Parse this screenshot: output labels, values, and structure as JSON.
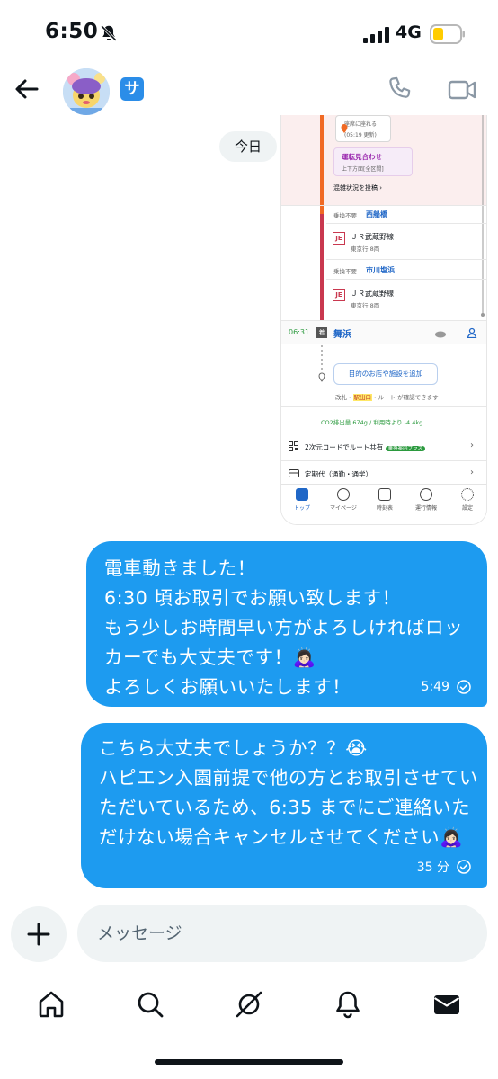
{
  "status_bar": {
    "time": "6:50",
    "network": "4G"
  },
  "header": {
    "badge": "サ"
  },
  "date_chip": "今日",
  "shared_image": {
    "location_card": {
      "line1": "座席に座れる",
      "line2": "(05:19 更新)"
    },
    "alert_card": {
      "title": "運転見合わせ",
      "sub": "上下方面[全区間]"
    },
    "congestion": "混雑状況を投稿",
    "stops": [
      {
        "transfer": "乗換不要",
        "station": "西船橋",
        "line": "ＪＲ武蔵野線",
        "dest": "東京行 8両"
      },
      {
        "transfer": "乗換不要",
        "station": "市川塩浜",
        "line": "ＪＲ武蔵野線",
        "dest": "東京行 8両"
      }
    ],
    "jr_mark": "JE",
    "arrival": {
      "time": "06:31",
      "marker": "着",
      "station": "舞浜"
    },
    "add_button": "目的のお店や施設を追加",
    "route_note_pre": "改札・",
    "route_note_exit": "駅出口",
    "route_note_post": "・ルート が確認できます",
    "co2": "CO2排出量 674g / 利用時より -4.4kg",
    "qr_share": "2次元コードでルート共有",
    "qr_badge": "乗換案内プラス",
    "commuter": "定期代（通勤・通学）",
    "tabs": [
      "トップ",
      "マイページ",
      "時刻表",
      "運行情報",
      "設定"
    ]
  },
  "messages": [
    {
      "text": "電車動きました！\n6:30 頃お取引でお願い致します！\nもう少しお時間早い方がよろしければロッカーでも大丈夫です！🙇🏻‍♀️\nよろしくお願いいたします！",
      "time": "5:49"
    },
    {
      "text": "こちら大丈夫でしょうか？？😭\nハピエン入園前提で他の方とお取引させていただいているため、6:35 までにご連絡いただけない場合キャンセルさせてください🙇🏻‍♀️",
      "time": "35 分"
    }
  ],
  "composer": {
    "placeholder": "メッセージ"
  },
  "colors": {
    "bubble": "#1d9bf0",
    "chip": "#eff3f4",
    "line_red": "#c9384f",
    "line_orange": "#f06a24"
  },
  "nav": [
    "home-icon",
    "search-icon",
    "grok-icon",
    "notifications-icon",
    "messages-icon"
  ]
}
